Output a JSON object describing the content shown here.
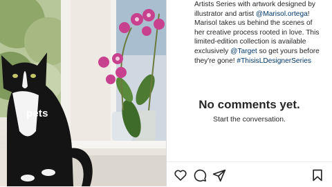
{
  "photo": {
    "tag": "pets"
  },
  "caption": {
    "line1": "Artists Series with artwork designed by",
    "line2_prefix": "illustrator and artist ",
    "mention_artist": "@Marisol.ortega",
    "line2_suffix": "!",
    "line3": "Marisol takes us behind the scenes of",
    "line4": "her creative process rooted in love. This",
    "line5": "limited-edition collection is available",
    "line6_prefix": "exclusively ",
    "mention_target": "@Target",
    "line6_suffix": " so get yours before",
    "line7_prefix": "they're gone! ",
    "hashtag": "#ThisisLDesignerSeries"
  },
  "comments": {
    "empty_title": "No comments yet.",
    "empty_subtitle": "Start the conversation."
  },
  "actions": {
    "like_icon": "heart-icon",
    "comment_icon": "comment-icon",
    "share_icon": "share-icon",
    "save_icon": "bookmark-icon"
  },
  "colors": {
    "text": "#262626",
    "link": "#00376b",
    "border": "#dbdbdb"
  }
}
